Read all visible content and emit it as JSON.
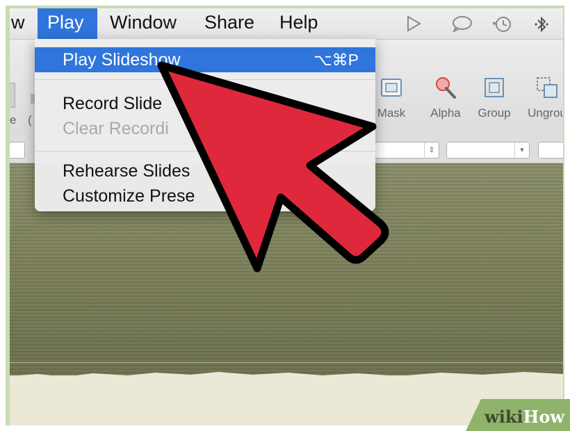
{
  "menubar": {
    "items": [
      {
        "label": "w"
      },
      {
        "label": "Play",
        "active": true
      },
      {
        "label": "Window"
      },
      {
        "label": "Share"
      },
      {
        "label": "Help"
      }
    ],
    "status_icons": [
      "play-triangle-icon",
      "speech-bubble-icon",
      "time-machine-icon",
      "bluetooth-icon"
    ]
  },
  "play_menu": {
    "items": [
      {
        "label": "Play Slideshow",
        "shortcut": "⌥⌘P",
        "highlighted": true
      },
      {
        "label": "Record Slide"
      },
      {
        "label": "Clear Recordi",
        "disabled": true
      },
      {
        "label": "Rehearse Slides"
      },
      {
        "label": "Customize Prese"
      }
    ]
  },
  "toolbar": {
    "left_partial_labels": [
      "e",
      "("
    ],
    "tools": [
      {
        "label": "Mask",
        "icon": "mask-icon"
      },
      {
        "label": "Alpha",
        "icon": "alpha-magic-wand-icon"
      },
      {
        "label": "Group",
        "icon": "group-icon"
      },
      {
        "label": "Ungrou",
        "icon": "ungroup-icon"
      }
    ]
  },
  "colors": {
    "accent": "#2f75dc",
    "arrow_fill": "#e0283c",
    "arrow_stroke": "#000000",
    "frame_green": "#c8dcb0"
  },
  "watermark": {
    "wiki": "wiki",
    "how": "How"
  }
}
